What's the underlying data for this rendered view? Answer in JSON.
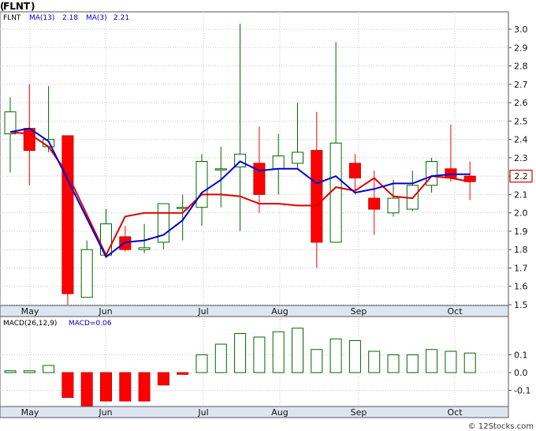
{
  "chart_data": [
    {
      "type": "candlestick",
      "ticker": "FLNT",
      "indicators": [
        {
          "label": "MA(13)",
          "value": "2.18",
          "color": "#dd0000"
        },
        {
          "label": "MA(3)",
          "value": "2.21",
          "color": "#0000cc"
        }
      ],
      "last_price_label": "2.2",
      "ylim": [
        1.48,
        3.1
      ],
      "yticks": [
        "1.5",
        "1.6",
        "1.7",
        "1.8",
        "1.9",
        "2.0",
        "2.1",
        "2.2",
        "2.3",
        "2.4",
        "2.5",
        "2.6",
        "2.7",
        "2.8",
        "2.9",
        "3.0"
      ],
      "xticks": [
        "May",
        "Jun",
        "Jul",
        "Aug",
        "Sep",
        "Oct"
      ],
      "grid": true,
      "colors": {
        "up": "#006600",
        "down": "#ff0000",
        "grid": "#c8c8c8",
        "axis_band": "#dde6f0"
      },
      "candles": [
        {
          "o": 2.43,
          "h": 2.63,
          "l": 2.22,
          "c": 2.55
        },
        {
          "o": 2.46,
          "h": 2.7,
          "l": 2.15,
          "c": 2.34
        },
        {
          "o": 2.36,
          "h": 2.69,
          "l": 2.33,
          "c": 2.4
        },
        {
          "o": 2.42,
          "h": 2.42,
          "l": 1.5,
          "c": 1.56
        },
        {
          "o": 1.54,
          "h": 1.85,
          "l": 1.54,
          "c": 1.8
        },
        {
          "o": 1.77,
          "h": 2.02,
          "l": 1.76,
          "c": 1.94
        },
        {
          "o": 1.87,
          "h": 1.93,
          "l": 1.79,
          "c": 1.8
        },
        {
          "o": 1.8,
          "h": 1.94,
          "l": 1.78,
          "c": 1.81
        },
        {
          "o": 1.84,
          "h": 2.05,
          "l": 1.8,
          "c": 2.05
        },
        {
          "o": 2.03,
          "h": 2.1,
          "l": 1.85,
          "c": 2.03
        },
        {
          "o": 2.03,
          "h": 2.32,
          "l": 1.93,
          "c": 2.28
        },
        {
          "o": 2.24,
          "h": 2.36,
          "l": 2.03,
          "c": 2.24
        },
        {
          "o": 2.25,
          "h": 3.03,
          "l": 1.9,
          "c": 2.32
        },
        {
          "o": 2.27,
          "h": 2.47,
          "l": 2.0,
          "c": 2.1
        },
        {
          "o": 2.24,
          "h": 2.43,
          "l": 2.1,
          "c": 2.31
        },
        {
          "o": 2.27,
          "h": 2.6,
          "l": 2.24,
          "c": 2.33
        },
        {
          "o": 2.34,
          "h": 2.55,
          "l": 1.7,
          "c": 1.84
        },
        {
          "o": 1.84,
          "h": 2.93,
          "l": 1.84,
          "c": 2.38
        },
        {
          "o": 2.27,
          "h": 2.32,
          "l": 2.1,
          "c": 2.19
        },
        {
          "o": 2.08,
          "h": 2.23,
          "l": 1.88,
          "c": 2.02
        },
        {
          "o": 2.0,
          "h": 2.18,
          "l": 1.98,
          "c": 2.08
        },
        {
          "o": 2.02,
          "h": 2.23,
          "l": 2.01,
          "c": 2.15
        },
        {
          "o": 2.15,
          "h": 2.3,
          "l": 2.11,
          "c": 2.28
        },
        {
          "o": 2.24,
          "h": 2.48,
          "l": 2.17,
          "c": 2.19
        },
        {
          "o": 2.2,
          "h": 2.28,
          "l": 2.07,
          "c": 2.17
        }
      ],
      "ma13": [
        [
          0,
          2.44
        ],
        [
          1,
          2.43
        ],
        [
          2,
          2.36
        ],
        [
          3,
          2.21
        ],
        [
          5,
          1.77
        ],
        [
          6,
          1.98
        ],
        [
          7,
          2.0
        ],
        [
          8,
          2.0
        ],
        [
          9,
          2.0
        ],
        [
          10,
          2.1
        ],
        [
          11,
          2.1
        ],
        [
          12,
          2.09
        ],
        [
          13,
          2.05
        ],
        [
          14,
          2.05
        ],
        [
          15,
          2.04
        ],
        [
          16,
          2.04
        ],
        [
          17,
          2.14
        ],
        [
          18,
          2.12
        ],
        [
          19,
          2.19
        ],
        [
          20,
          2.09
        ],
        [
          21,
          2.08
        ],
        [
          22,
          2.2
        ],
        [
          23,
          2.19
        ],
        [
          24,
          2.17
        ]
      ],
      "ma3": [
        [
          0,
          2.44
        ],
        [
          1,
          2.46
        ],
        [
          2,
          2.39
        ],
        [
          5,
          1.76
        ],
        [
          6,
          1.84
        ],
        [
          7,
          1.85
        ],
        [
          8,
          1.88
        ],
        [
          9,
          1.96
        ],
        [
          10,
          2.11
        ],
        [
          11,
          2.18
        ],
        [
          12,
          2.28
        ],
        [
          13,
          2.23
        ],
        [
          14,
          2.24
        ],
        [
          15,
          2.24
        ],
        [
          16,
          2.16
        ],
        [
          17,
          2.2
        ],
        [
          18,
          2.11
        ],
        [
          19,
          2.13
        ],
        [
          20,
          2.16
        ],
        [
          21,
          2.16
        ],
        [
          22,
          2.2
        ],
        [
          23,
          2.21
        ],
        [
          24,
          2.21
        ]
      ]
    },
    {
      "type": "bar",
      "title": "MACD(26,12,9)",
      "macd_label": "MACD=0.06",
      "ylim": [
        -0.19,
        0.16
      ],
      "yticks": [
        "0.1",
        "0.0",
        "-0.1"
      ],
      "xticks": [
        "May",
        "Jun",
        "Jul",
        "Aug",
        "Sep",
        "Oct"
      ],
      "colors": {
        "positive": "#006600",
        "negative": "#ff0000"
      },
      "values": [
        0.01,
        0.01,
        0.04,
        -0.14,
        -0.19,
        -0.16,
        -0.16,
        -0.16,
        -0.07,
        -0.01,
        0.1,
        0.16,
        0.22,
        0.2,
        0.23,
        0.25,
        0.13,
        0.19,
        0.18,
        0.12,
        0.1,
        0.1,
        0.13,
        0.12,
        0.11
      ]
    }
  ],
  "watermark": "© 12Stocks.com"
}
